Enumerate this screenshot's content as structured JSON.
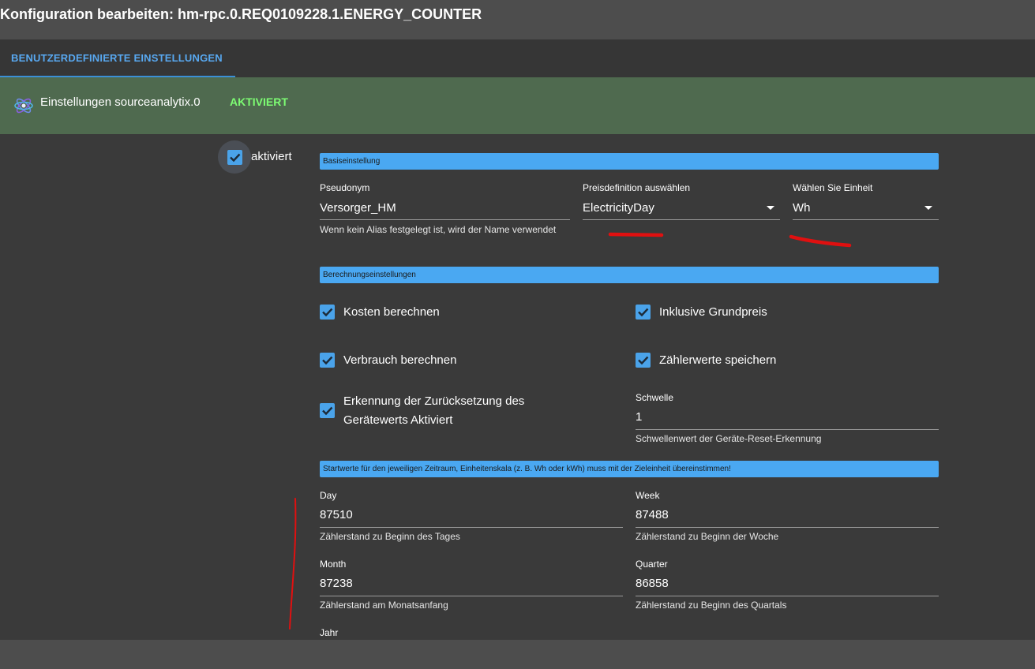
{
  "window": {
    "title": "Konfiguration bearbeiten: hm-rpc.0.REQ0109228.1.ENERGY_COUNTER"
  },
  "tabs": [
    {
      "label": "BENUTZERDEFINIERTE EINSTELLUNGEN",
      "active": true
    }
  ],
  "adapter": {
    "name": "Einstellungen sourceanalytix.0",
    "status": "AKTIVIERT",
    "status_color": "#7dfc73",
    "icon": "atom-icon"
  },
  "enabled": {
    "label": "aktiviert",
    "checked": true
  },
  "sections": {
    "basic": "Basiseinstellung",
    "calculation": "Berechnungseinstellungen",
    "start_values": "Startwerte für den jeweiligen Zeitraum, Einheitenskala (z. B. Wh oder kWh) muss mit der Zieleinheit übereinstimmen!"
  },
  "basic": {
    "alias": {
      "label": "Pseudonym",
      "value": "Versorger_HM",
      "helper": "Wenn kein Alias festgelegt ist, wird der Name verwendet"
    },
    "price": {
      "label": "Preisdefinition auswählen",
      "value": "ElectricityDay"
    },
    "unit": {
      "label": "Wählen Sie Einheit",
      "value": "Wh"
    }
  },
  "calculation": {
    "costs": {
      "label": "Kosten berechnen",
      "checked": true
    },
    "base_price": {
      "label": "Inklusive Grundpreis",
      "checked": true
    },
    "consumption": {
      "label": "Verbrauch berechnen",
      "checked": true
    },
    "save_counter": {
      "label": "Zählerwerte speichern",
      "checked": true
    },
    "reset_detection": {
      "label": "Erkennung der Zurücksetzung des Gerätewerts Aktiviert",
      "checked": true
    },
    "threshold": {
      "label": "Schwelle",
      "value": "1",
      "helper": "Schwellenwert der Geräte-Reset-Erkennung"
    }
  },
  "start_values": {
    "day": {
      "label": "Day",
      "value": "87510",
      "helper": "Zählerstand zu Beginn des Tages"
    },
    "week": {
      "label": "Week",
      "value": "87488",
      "helper": "Zählerstand zu Beginn der Woche"
    },
    "month": {
      "label": "Month",
      "value": "87238",
      "helper": "Zählerstand am Monatsanfang"
    },
    "quarter": {
      "label": "Quarter",
      "value": "86858",
      "helper": "Zählerstand zu Beginn des Quartals"
    },
    "year": {
      "label": "Jahr"
    }
  },
  "colors": {
    "accent": "#4aa8f2",
    "annotation": "#e01010"
  }
}
